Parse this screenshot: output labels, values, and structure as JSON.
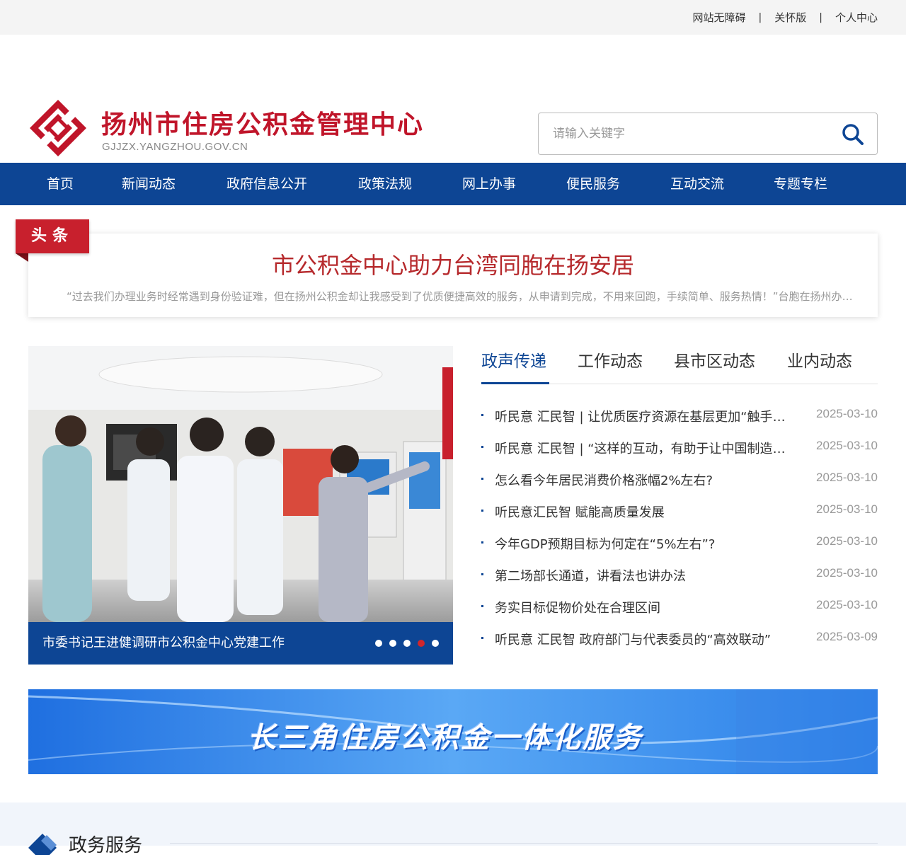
{
  "topbar": {
    "links": [
      "网站无障碍",
      "关怀版",
      "个人中心"
    ],
    "separator": "|"
  },
  "header": {
    "title": "扬州市住房公积金管理中心",
    "subtitle": "GJJZX.YANGZHOU.GOV.CN",
    "logo_icon": "housing-fund-logo",
    "brand_color": "#c0152a"
  },
  "search": {
    "placeholder": "请输入关键字",
    "icon": "search-icon"
  },
  "nav": {
    "color": "#0d4594",
    "items": [
      "首页",
      "新闻动态",
      "政府信息公开",
      "政策法规",
      "网上办事",
      "便民服务",
      "互动交流",
      "专题专栏"
    ]
  },
  "headline": {
    "tag": "头条",
    "title": "市公积金中心助力台湾同胞在扬安居",
    "summary": "“过去我们办理业务时经常遇到身份验证难，但在扬州公积金却让我感受到了优质便捷高效的服务，从申请到完成，不用来回跑，手续简单、服务热情！”台胞在扬州办理公积金业务时说道。"
  },
  "slider": {
    "caption": "市委书记王进健调研市公积金中心党建工作",
    "dot_count": 5,
    "active_dot": 4
  },
  "news": {
    "tabs": [
      "政声传递",
      "工作动态",
      "县市区动态",
      "业内动态"
    ],
    "active_tab": 0,
    "items": [
      {
        "title": "听民意 汇民智 | 让优质医疗资源在基层更加“触手可及”",
        "date": "2025-03-10"
      },
      {
        "title": "听民意 汇民智 | “这样的互动，有助于让中国制造变得更好”",
        "date": "2025-03-10"
      },
      {
        "title": "怎么看今年居民消费价格涨幅2%左右?",
        "date": "2025-03-10"
      },
      {
        "title": "听民意汇民智 赋能高质量发展",
        "date": "2025-03-10"
      },
      {
        "title": "今年GDP预期目标为何定在“5%左右”?",
        "date": "2025-03-10"
      },
      {
        "title": "第二场部长通道，讲看法也讲办法",
        "date": "2025-03-10"
      },
      {
        "title": "务实目标促物价处在合理区间",
        "date": "2025-03-10"
      },
      {
        "title": "听民意 汇民智 政府部门与代表委员的“高效联动”",
        "date": "2025-03-09"
      }
    ]
  },
  "banner": {
    "text": "长三角住房公积金一体化服务"
  },
  "section": {
    "title": "政务服务",
    "icon": "diamond-icon"
  }
}
